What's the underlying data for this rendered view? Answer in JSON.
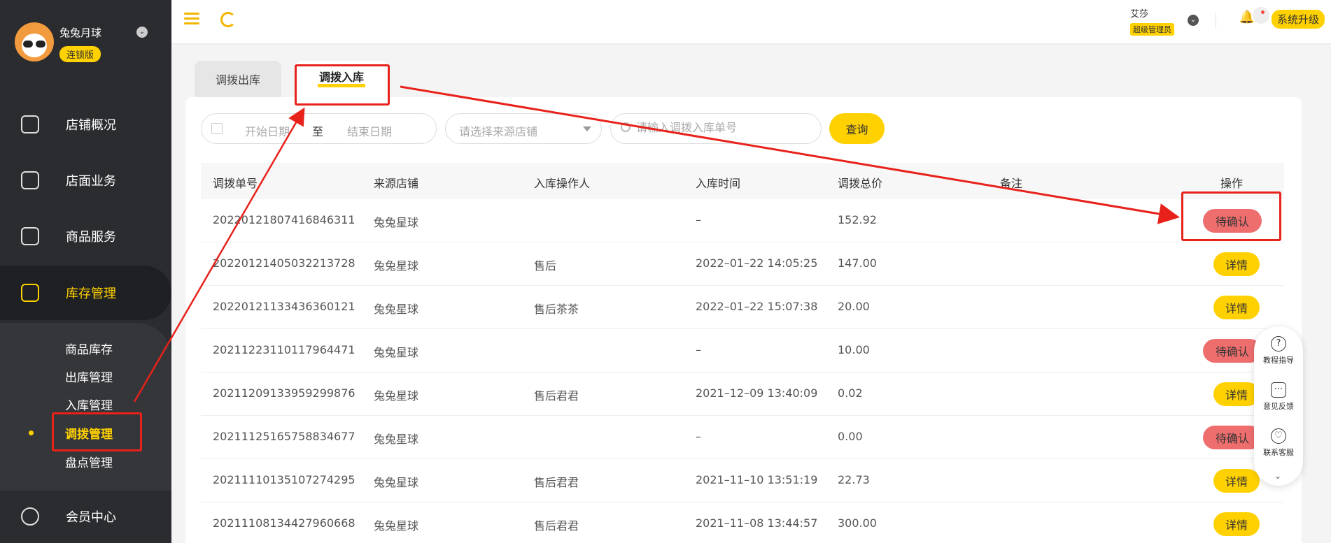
{
  "sidebar": {
    "brand_name": "兔兔月球",
    "brand_badge": "连锁版",
    "chevron": "⌄",
    "nav": [
      {
        "label": "店铺概况",
        "icon": "monitor-icon"
      },
      {
        "label": "店面业务",
        "icon": "home-icon"
      },
      {
        "label": "商品服务",
        "icon": "bag-icon"
      },
      {
        "label": "库存管理",
        "icon": "box-icon"
      },
      {
        "label": "会员中心",
        "icon": "member-icon"
      }
    ],
    "submenu": [
      "商品库存",
      "出库管理",
      "入库管理",
      "调拨管理",
      "盘点管理"
    ]
  },
  "header": {
    "user_name": "艾莎",
    "user_role": "超级管理员",
    "upgrade_label": "系统升级",
    "chevron": "⌄",
    "bell": "🔔"
  },
  "tabs": {
    "out": "调拨出库",
    "in": "调拨入库"
  },
  "filters": {
    "start_date": "开始日期",
    "to": "至",
    "end_date": "结束日期",
    "store_placeholder": "请选择来源店铺",
    "search_placeholder": "请输入调拨入库单号",
    "query_label": "查询"
  },
  "table": {
    "headers": [
      "调拨单号",
      "来源店铺",
      "入库操作人",
      "入库时间",
      "调拨总价",
      "备注",
      "操作"
    ],
    "rows": [
      {
        "no": "20220121807416846311",
        "store": "兔兔星球",
        "operator": "",
        "time": "–",
        "total": "152.92",
        "remark": "",
        "action": "待确认"
      },
      {
        "no": "20220121405032213728",
        "store": "兔兔星球",
        "operator": "售后",
        "time": "2022–01–22 14:05:25",
        "total": "147.00",
        "remark": "",
        "action": "详情"
      },
      {
        "no": "20220121133436360121",
        "store": "兔兔星球",
        "operator": "售后茶茶",
        "time": "2022–01–22 15:07:38",
        "total": "20.00",
        "remark": "",
        "action": "详情"
      },
      {
        "no": "20211223110117964471",
        "store": "兔兔星球",
        "operator": "",
        "time": "–",
        "total": "10.00",
        "remark": "",
        "action": "待确认"
      },
      {
        "no": "20211209133959299876",
        "store": "兔兔星球",
        "operator": "售后君君",
        "time": "2021–12–09 13:40:09",
        "total": "0.02",
        "remark": "",
        "action": "详情"
      },
      {
        "no": "20211125165758834677",
        "store": "兔兔星球",
        "operator": "",
        "time": "–",
        "total": "0.00",
        "remark": "",
        "action": "待确认"
      },
      {
        "no": "20211110135107274295",
        "store": "兔兔星球",
        "operator": "售后君君",
        "time": "2021–11–10 13:51:19",
        "total": "22.73",
        "remark": "",
        "action": "详情"
      },
      {
        "no": "20211108134427960668",
        "store": "兔兔星球",
        "operator": "售后君君",
        "time": "2021–11–08 13:44:57",
        "total": "300.00",
        "remark": "",
        "action": "详情"
      }
    ]
  },
  "float_help": {
    "items": [
      {
        "label": "教程指导",
        "glyph": "?"
      },
      {
        "label": "意见反馈",
        "glyph": "···"
      },
      {
        "label": "联系客服",
        "glyph": "♡"
      }
    ],
    "more": "⌄"
  },
  "colors": {
    "accent": "#ffd100",
    "danger": "#ee6e6e",
    "annotation": "#e8211b",
    "sidebar": "#2b2c2f"
  }
}
